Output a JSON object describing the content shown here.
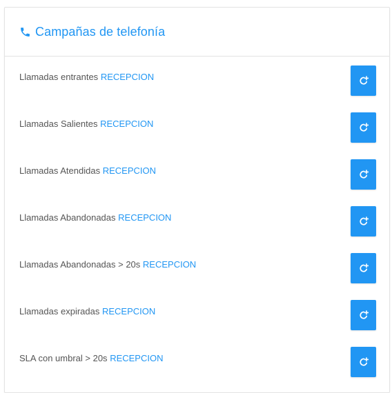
{
  "colors": {
    "accent": "#2196f3",
    "text": "#555555",
    "button_bg": "#2196f3",
    "button_icon": "#ffffff"
  },
  "header": {
    "icon": "phone-icon",
    "title": "Campañas de telefonía"
  },
  "rows": [
    {
      "label": "Llamadas entrantes",
      "queue": "RECEPCION",
      "action_icon": "refresh-icon"
    },
    {
      "label": "Llamadas Salientes",
      "queue": "RECEPCION",
      "action_icon": "refresh-icon"
    },
    {
      "label": "Llamadas Atendidas",
      "queue": "RECEPCION",
      "action_icon": "refresh-icon"
    },
    {
      "label": "Llamadas Abandonadas",
      "queue": "RECEPCION",
      "action_icon": "refresh-icon"
    },
    {
      "label": "Llamadas Abandonadas > 20s",
      "queue": "RECEPCION",
      "action_icon": "refresh-icon"
    },
    {
      "label": "Llamadas expiradas",
      "queue": "RECEPCION",
      "action_icon": "refresh-icon"
    },
    {
      "label": "SLA con umbral > 20s",
      "queue": "RECEPCION",
      "action_icon": "refresh-icon"
    }
  ]
}
